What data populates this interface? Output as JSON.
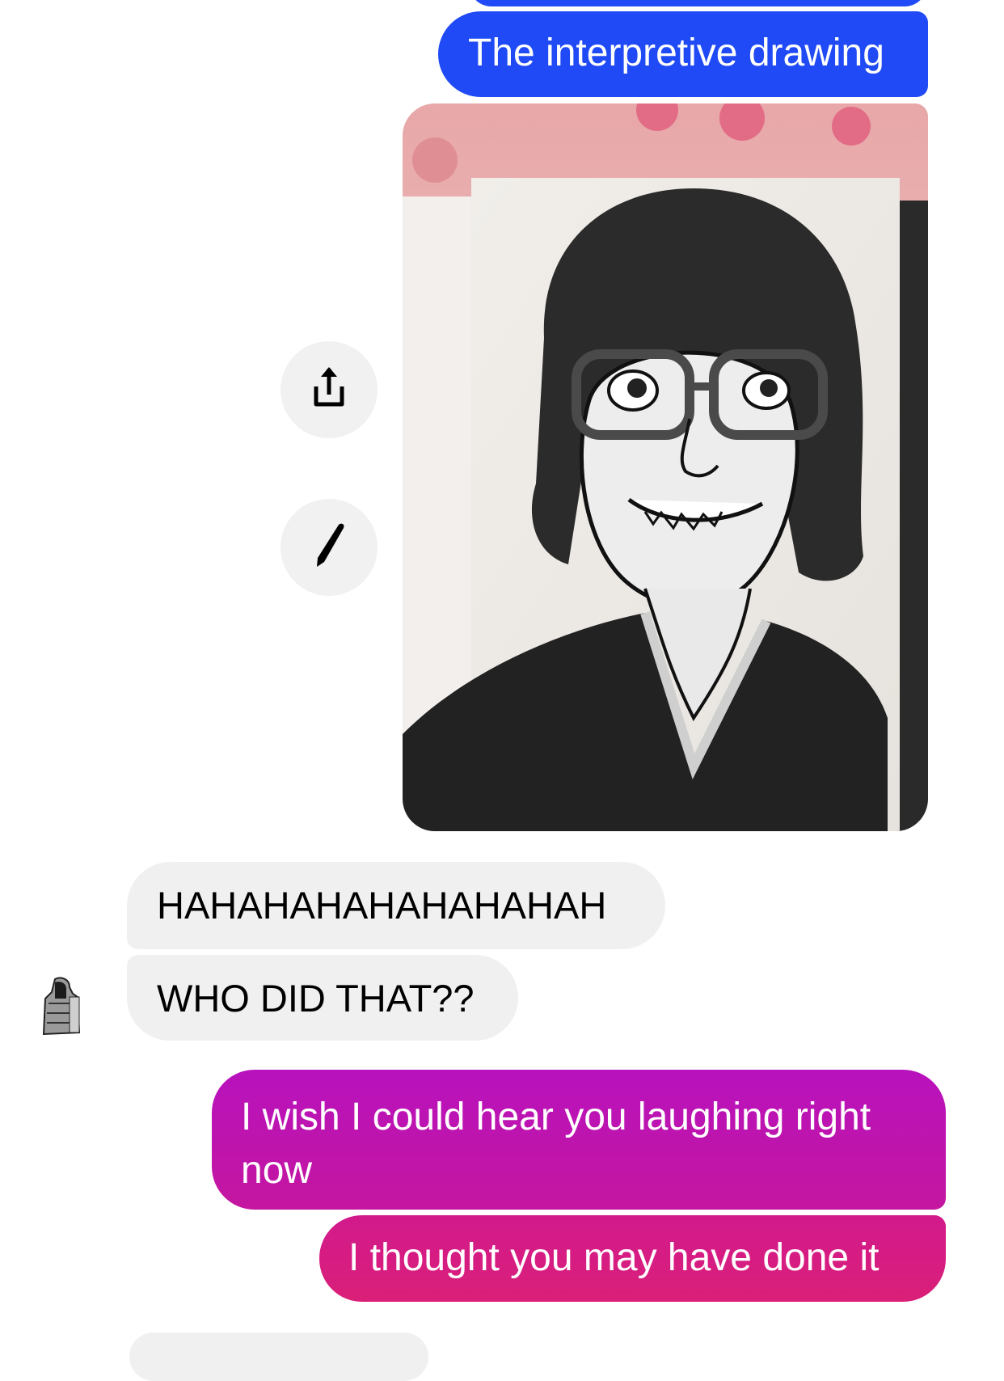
{
  "messages": {
    "sent_drawing": "The interpretive drawing",
    "received_1": "HAHAHAHAHAHAHAHAH",
    "received_2": "WHO DID THAT??",
    "sent_wish": "I wish I could hear you laughing right now",
    "sent_thought": "I thought you may have done it"
  },
  "actions": {
    "share_icon": "share-icon",
    "edit_icon": "pencil-icon"
  },
  "colors": {
    "outgoing_blue": "#1f4af5",
    "outgoing_magenta": "#b812bd",
    "outgoing_pink": "#d21a8c",
    "incoming_gray": "#f0f0f0"
  }
}
